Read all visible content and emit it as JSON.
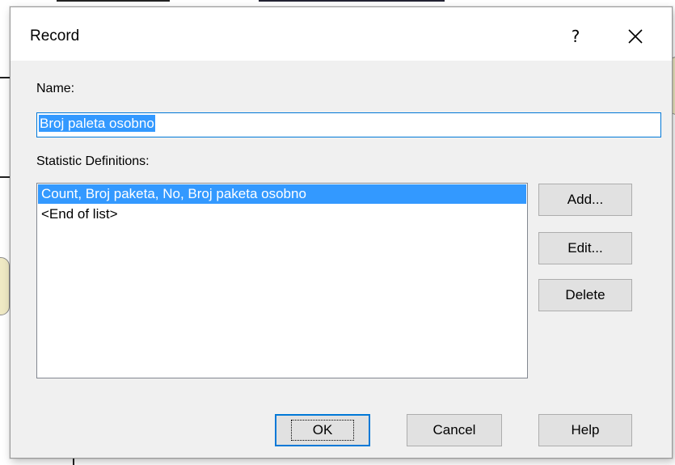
{
  "window": {
    "title": "Record",
    "help_glyph": "?",
    "close_icon": "close-icon"
  },
  "form": {
    "name_label": "Name:",
    "name_value": "Broj paleta osobno",
    "stats_label": "Statistic Definitions:"
  },
  "list": {
    "items": [
      {
        "text": "Count, Broj paketa, No, Broj paketa osobno",
        "selected": true
      },
      {
        "text": "<End of list>",
        "selected": false
      }
    ]
  },
  "side_buttons": {
    "add": "Add...",
    "edit": "Edit...",
    "delete": "Delete"
  },
  "bottom_buttons": {
    "ok": "OK",
    "cancel": "Cancel",
    "help": "Help"
  },
  "colors": {
    "selection": "#3399ff",
    "focus_border": "#0078d7",
    "dialog_bg": "#f0f0f0"
  }
}
